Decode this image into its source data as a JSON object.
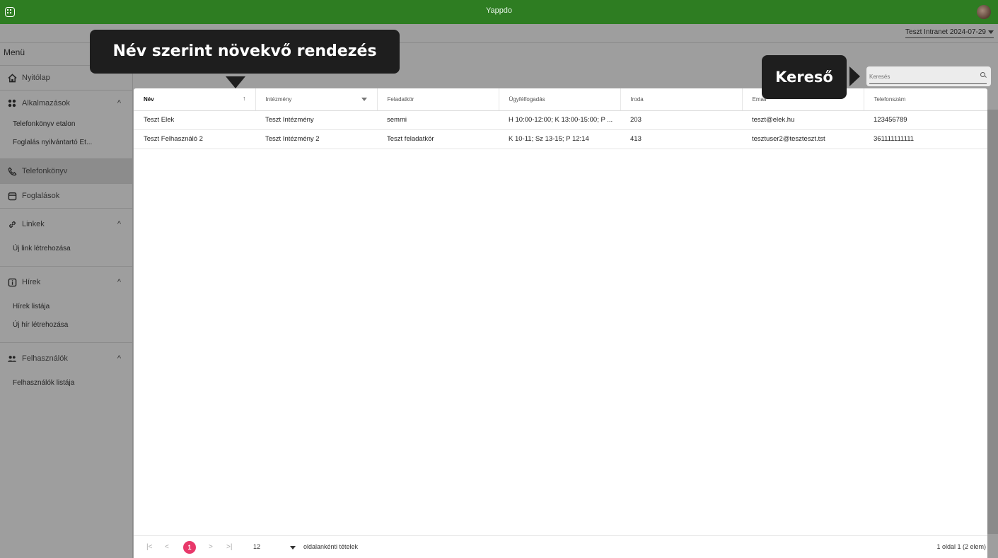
{
  "app": {
    "title": "Yappdo"
  },
  "header": {
    "intranet_label": "Teszt Intranet 2024-07-29"
  },
  "sidebar": {
    "menu_title": "Menü",
    "items": [
      {
        "label": "Nyitólap",
        "icon": "home-icon"
      },
      {
        "label": "Alkalmazások",
        "icon": "apps-icon",
        "sub": [
          "Telefonkönyv etalon",
          "Foglalás nyilvántartó Et..."
        ]
      },
      {
        "label": "Telefonkönyv",
        "icon": "phone-icon"
      },
      {
        "label": "Foglalások",
        "icon": "calendar-icon"
      },
      {
        "label": "Linkek",
        "icon": "link-icon",
        "sub": [
          "Új link létrehozása"
        ]
      },
      {
        "label": "Hírek",
        "icon": "info-icon",
        "sub": [
          "Hírek listája",
          "Új hír létrehozása"
        ]
      },
      {
        "label": "Felhasználók",
        "icon": "users-icon",
        "sub": [
          "Felhasználók listája"
        ]
      }
    ]
  },
  "search": {
    "placeholder": "Keresés"
  },
  "table": {
    "columns": [
      "Név",
      "Intézmény",
      "Feladatkör",
      "Ügyfélfogadás",
      "Iroda",
      "Email",
      "Telefonszám"
    ],
    "sort_indicator": "↑",
    "rows": [
      [
        "Teszt Elek",
        "Teszt Intézmény",
        "semmi",
        "H 10:00-12:00; K 13:00-15:00; P ...",
        "203",
        "teszt@elek.hu",
        "123456789"
      ],
      [
        "Teszt Felhasználó 2",
        "Teszt Intézmény 2",
        "Teszt feladatkör",
        "K 10-11; Sz 13-15; P 12:14",
        "413",
        "tesztuser2@teszteszt.tst",
        "361111111111"
      ]
    ]
  },
  "pagination": {
    "current_page": "1",
    "page_size": "12",
    "page_size_label": "oldalankénti tételek",
    "info": "1 oldal 1 (2 elem)",
    "first": "|<",
    "prev": "<",
    "next": ">",
    "last": ">|"
  },
  "callouts": {
    "sort": "Név szerint növekvő rendezés",
    "search": "Kereső"
  },
  "colors": {
    "topbar": "#2e7d22",
    "accent": "#e8386a",
    "callout": "#1e1e1e"
  }
}
